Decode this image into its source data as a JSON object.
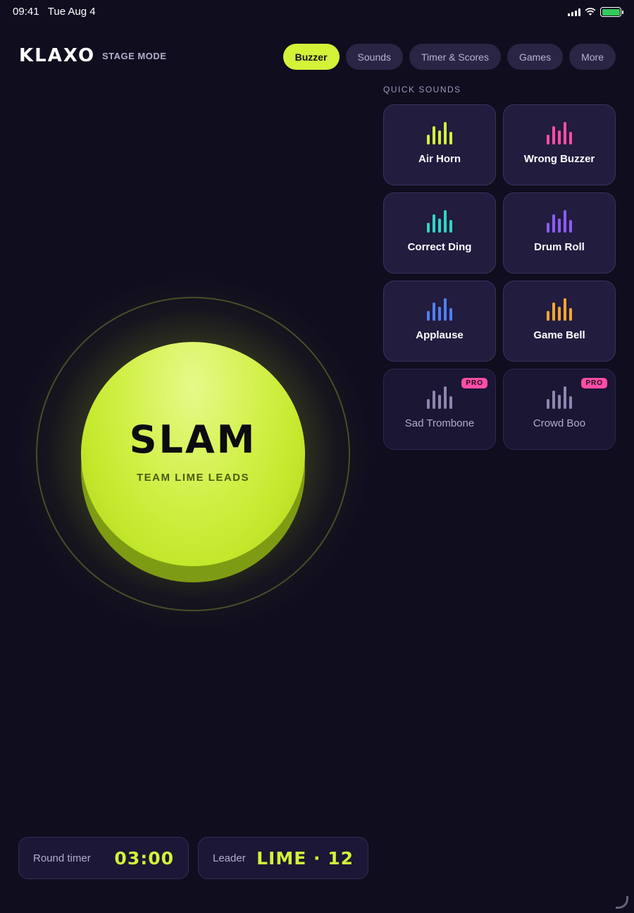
{
  "status_bar": {
    "time": "09:41",
    "date": "Tue Aug 4",
    "battery_color": "#34c759"
  },
  "header": {
    "logo": "KLAXO",
    "mode": "STAGE MODE",
    "tabs": [
      {
        "label": "Buzzer",
        "active": true
      },
      {
        "label": "Sounds",
        "active": false
      },
      {
        "label": "Timer & Scores",
        "active": false
      },
      {
        "label": "Games",
        "active": false
      },
      {
        "label": "More",
        "active": false
      }
    ]
  },
  "quick_sounds": {
    "title": "QUICK SOUNDS",
    "items": [
      {
        "label": "Air Horn",
        "color": "#d4f238",
        "icon": "waveform-icon",
        "pro": false
      },
      {
        "label": "Wrong Buzzer",
        "color": "#ff4da6",
        "icon": "waveform-icon",
        "pro": false
      },
      {
        "label": "Correct Ding",
        "color": "#2fd6c3",
        "icon": "waveform-icon",
        "pro": false
      },
      {
        "label": "Drum Roll",
        "color": "#8b5cf6",
        "icon": "waveform-icon",
        "pro": false
      },
      {
        "label": "Applause",
        "color": "#4f7ff0",
        "icon": "waveform-icon",
        "pro": false
      },
      {
        "label": "Game Bell",
        "color": "#f7a531",
        "icon": "waveform-icon",
        "pro": false
      },
      {
        "label": "Sad Trombone",
        "color": "#8d86b0",
        "icon": "waveform-icon",
        "pro": true,
        "badge": "PRO"
      },
      {
        "label": "Crowd Boo",
        "color": "#8d86b0",
        "icon": "waveform-icon",
        "pro": true,
        "badge": "PRO"
      }
    ]
  },
  "buzzer": {
    "label": "SLAM",
    "subtitle": "TEAM LIME LEADS",
    "color": "#d0f046"
  },
  "footer": {
    "round_timer": {
      "label": "Round timer",
      "value": "03:00"
    },
    "leader": {
      "label": "Leader",
      "value": "LIME · 12"
    }
  },
  "colors": {
    "background": "#100d1f",
    "accent": "#d4f238",
    "pro_badge": "#ff4da6"
  }
}
